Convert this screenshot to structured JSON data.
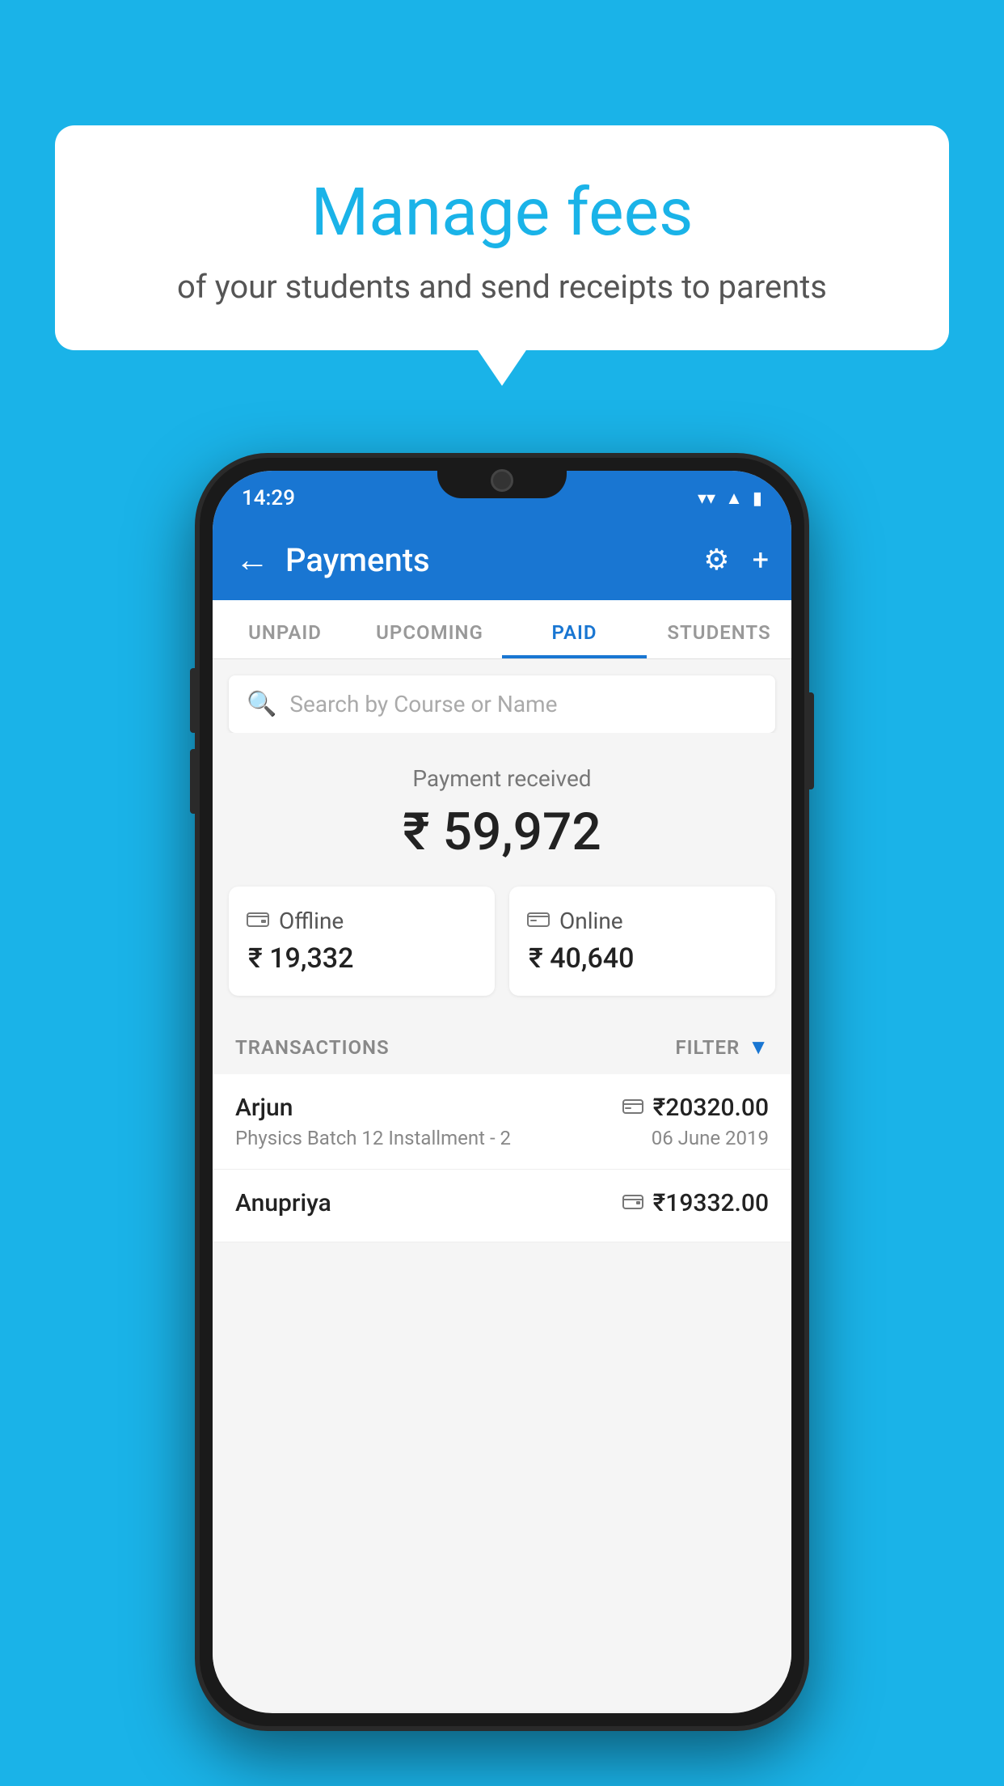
{
  "page": {
    "background_color": "#1ab3e8"
  },
  "speech_bubble": {
    "title": "Manage fees",
    "subtitle": "of your students and send receipts to parents"
  },
  "status_bar": {
    "time": "14:29",
    "wifi_icon": "▼",
    "signal_icon": "▲",
    "battery_icon": "▮"
  },
  "app_bar": {
    "back_icon": "←",
    "title": "Payments",
    "settings_icon": "⚙",
    "add_icon": "+"
  },
  "tabs": [
    {
      "label": "UNPAID",
      "active": false
    },
    {
      "label": "UPCOMING",
      "active": false
    },
    {
      "label": "PAID",
      "active": true
    },
    {
      "label": "STUDENTS",
      "active": false
    }
  ],
  "search": {
    "placeholder": "Search by Course or Name",
    "icon": "🔍"
  },
  "payment_summary": {
    "label": "Payment received",
    "amount": "₹ 59,972",
    "offline": {
      "type": "Offline",
      "amount": "₹ 19,332",
      "icon": "💳"
    },
    "online": {
      "type": "Online",
      "amount": "₹ 40,640",
      "icon": "💳"
    }
  },
  "transactions": {
    "label": "TRANSACTIONS",
    "filter_label": "FILTER",
    "rows": [
      {
        "name": "Arjun",
        "description": "Physics Batch 12 Installment - 2",
        "amount": "₹20320.00",
        "date": "06 June 2019",
        "icon": "💳"
      },
      {
        "name": "Anupriya",
        "description": "",
        "amount": "₹19332.00",
        "date": "",
        "icon": "💰"
      }
    ]
  }
}
